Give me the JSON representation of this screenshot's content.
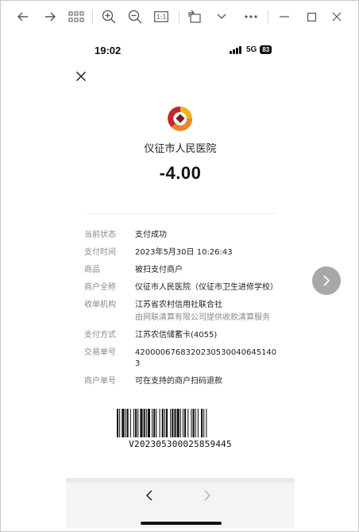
{
  "toolbar": {
    "icons": [
      "back-arrow-icon",
      "forward-arrow-icon",
      "grid-icon",
      "zoom-in-icon",
      "zoom-out-icon",
      "actual-size-icon",
      "rotate-icon",
      "chevron-down-icon",
      "more-icon",
      "minimize-icon",
      "maximize-icon",
      "close-icon"
    ],
    "actual_size_label": "1:1"
  },
  "status_bar": {
    "time": "19:02",
    "network": "5G",
    "battery": "83"
  },
  "receipt": {
    "merchant": "仪征市人民医院",
    "amount": "-4.00",
    "rows": [
      {
        "key": "当前状态",
        "value": "支付成功"
      },
      {
        "key": "支付时间",
        "value": "2023年5月30日 10:26:43"
      },
      {
        "key": "商品",
        "value": "被扫支付商户"
      },
      {
        "key": "商户全称",
        "value": "仪征市人民医院（仪征市卫生进修学校）"
      },
      {
        "key": "收单机构",
        "value": "江苏省农村信用社联合社",
        "sub": "由网联清算有限公司提供收款清算服务"
      },
      {
        "key": "支付方式",
        "value": "江苏农信储蓄卡(4055)"
      },
      {
        "key": "交易单号",
        "value": "4200006768320230530040645140 3"
      },
      {
        "key": "商户单号",
        "value": "可在支持的商户扫码退款"
      }
    ],
    "barcode_number": "V202305300025859445"
  },
  "colors": {
    "logo_orange": "#e8862a",
    "logo_red": "#c8242f",
    "logo_gold": "#f0b323"
  }
}
